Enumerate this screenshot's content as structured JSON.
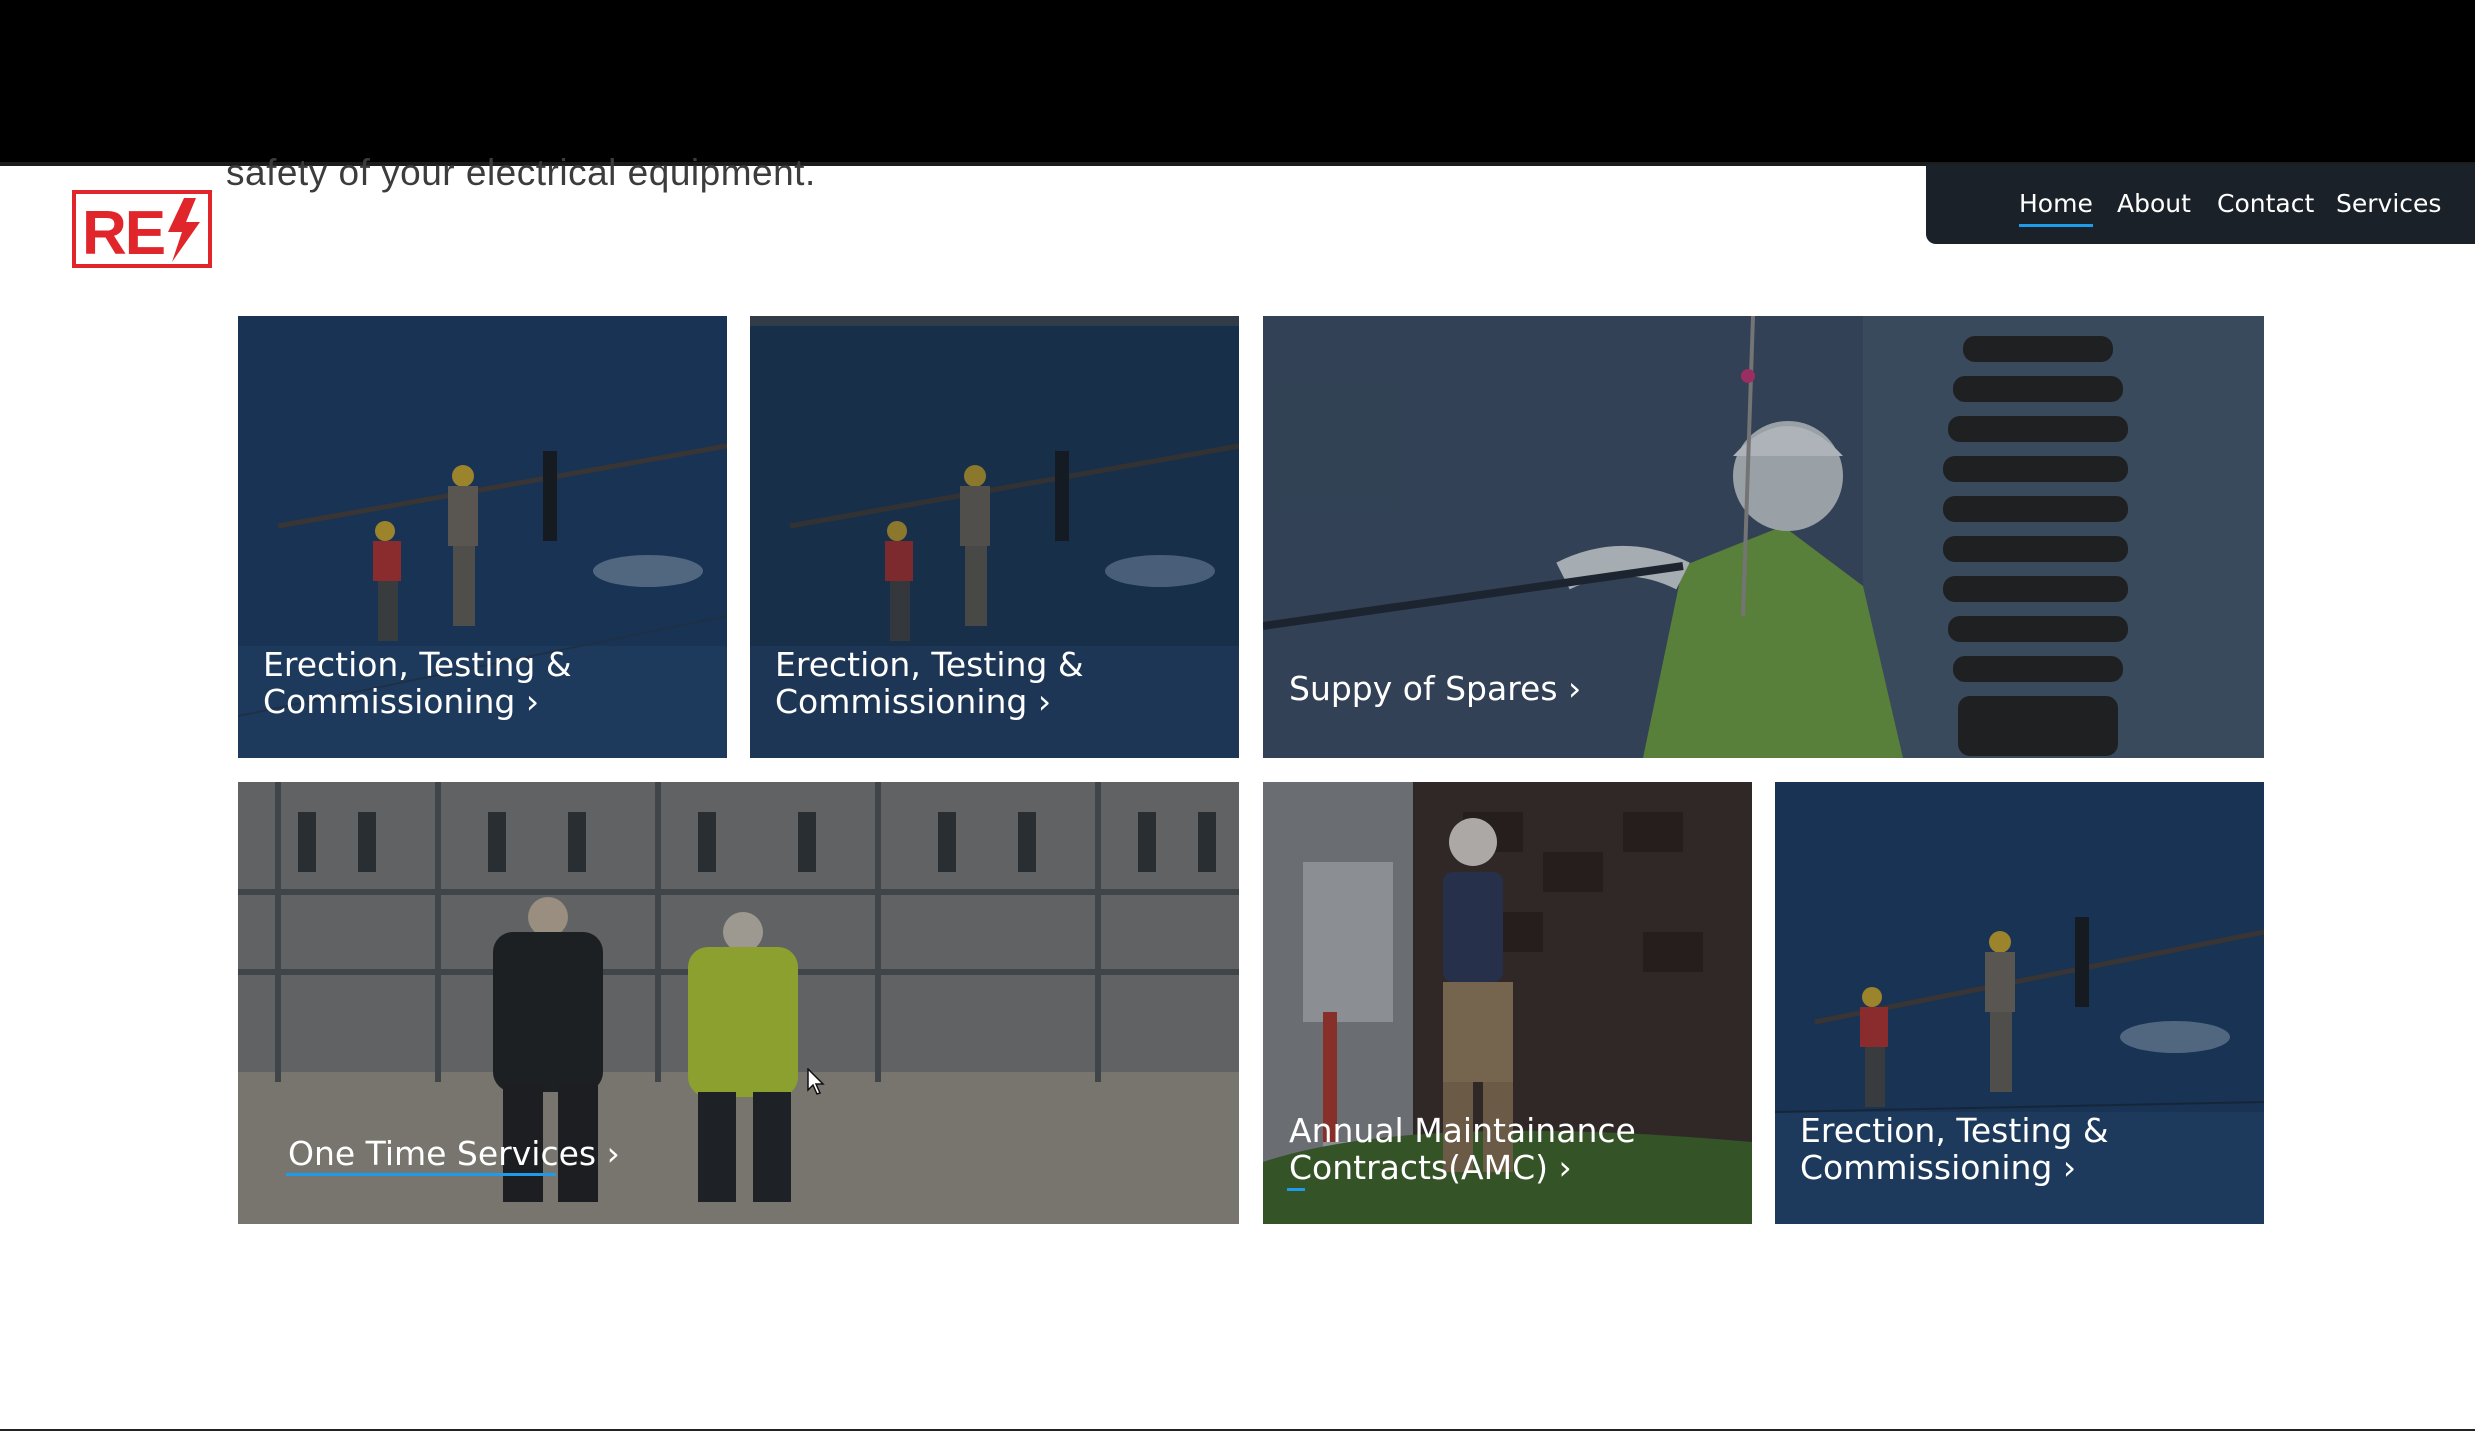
{
  "intro": {
    "text": "safety of your electrical equipment."
  },
  "brand": {
    "logo_letters": "RE",
    "accent_color": "#e0262b"
  },
  "nav": {
    "items": [
      {
        "label": "Home",
        "active": true
      },
      {
        "label": "About",
        "active": false
      },
      {
        "label": "Contact",
        "active": false
      },
      {
        "label": "Services",
        "active": false
      }
    ],
    "active_underline_color": "#1e9be9"
  },
  "services": {
    "cards": [
      {
        "title_line1": "Erection, Testing &",
        "title_line2": "Commissioning ›"
      },
      {
        "title_line1": "Erection, Testing &",
        "title_line2": "Commissioning ›"
      },
      {
        "title_line1": "Suppy of Spares ›"
      },
      {
        "title_line1": "One Time Services ›"
      },
      {
        "title_line1": "Annual Maintainance",
        "title_line2": "Contracts(AMC) ›"
      },
      {
        "title_line1": "Erection, Testing &",
        "title_line2": "Commissioning ›"
      }
    ]
  }
}
